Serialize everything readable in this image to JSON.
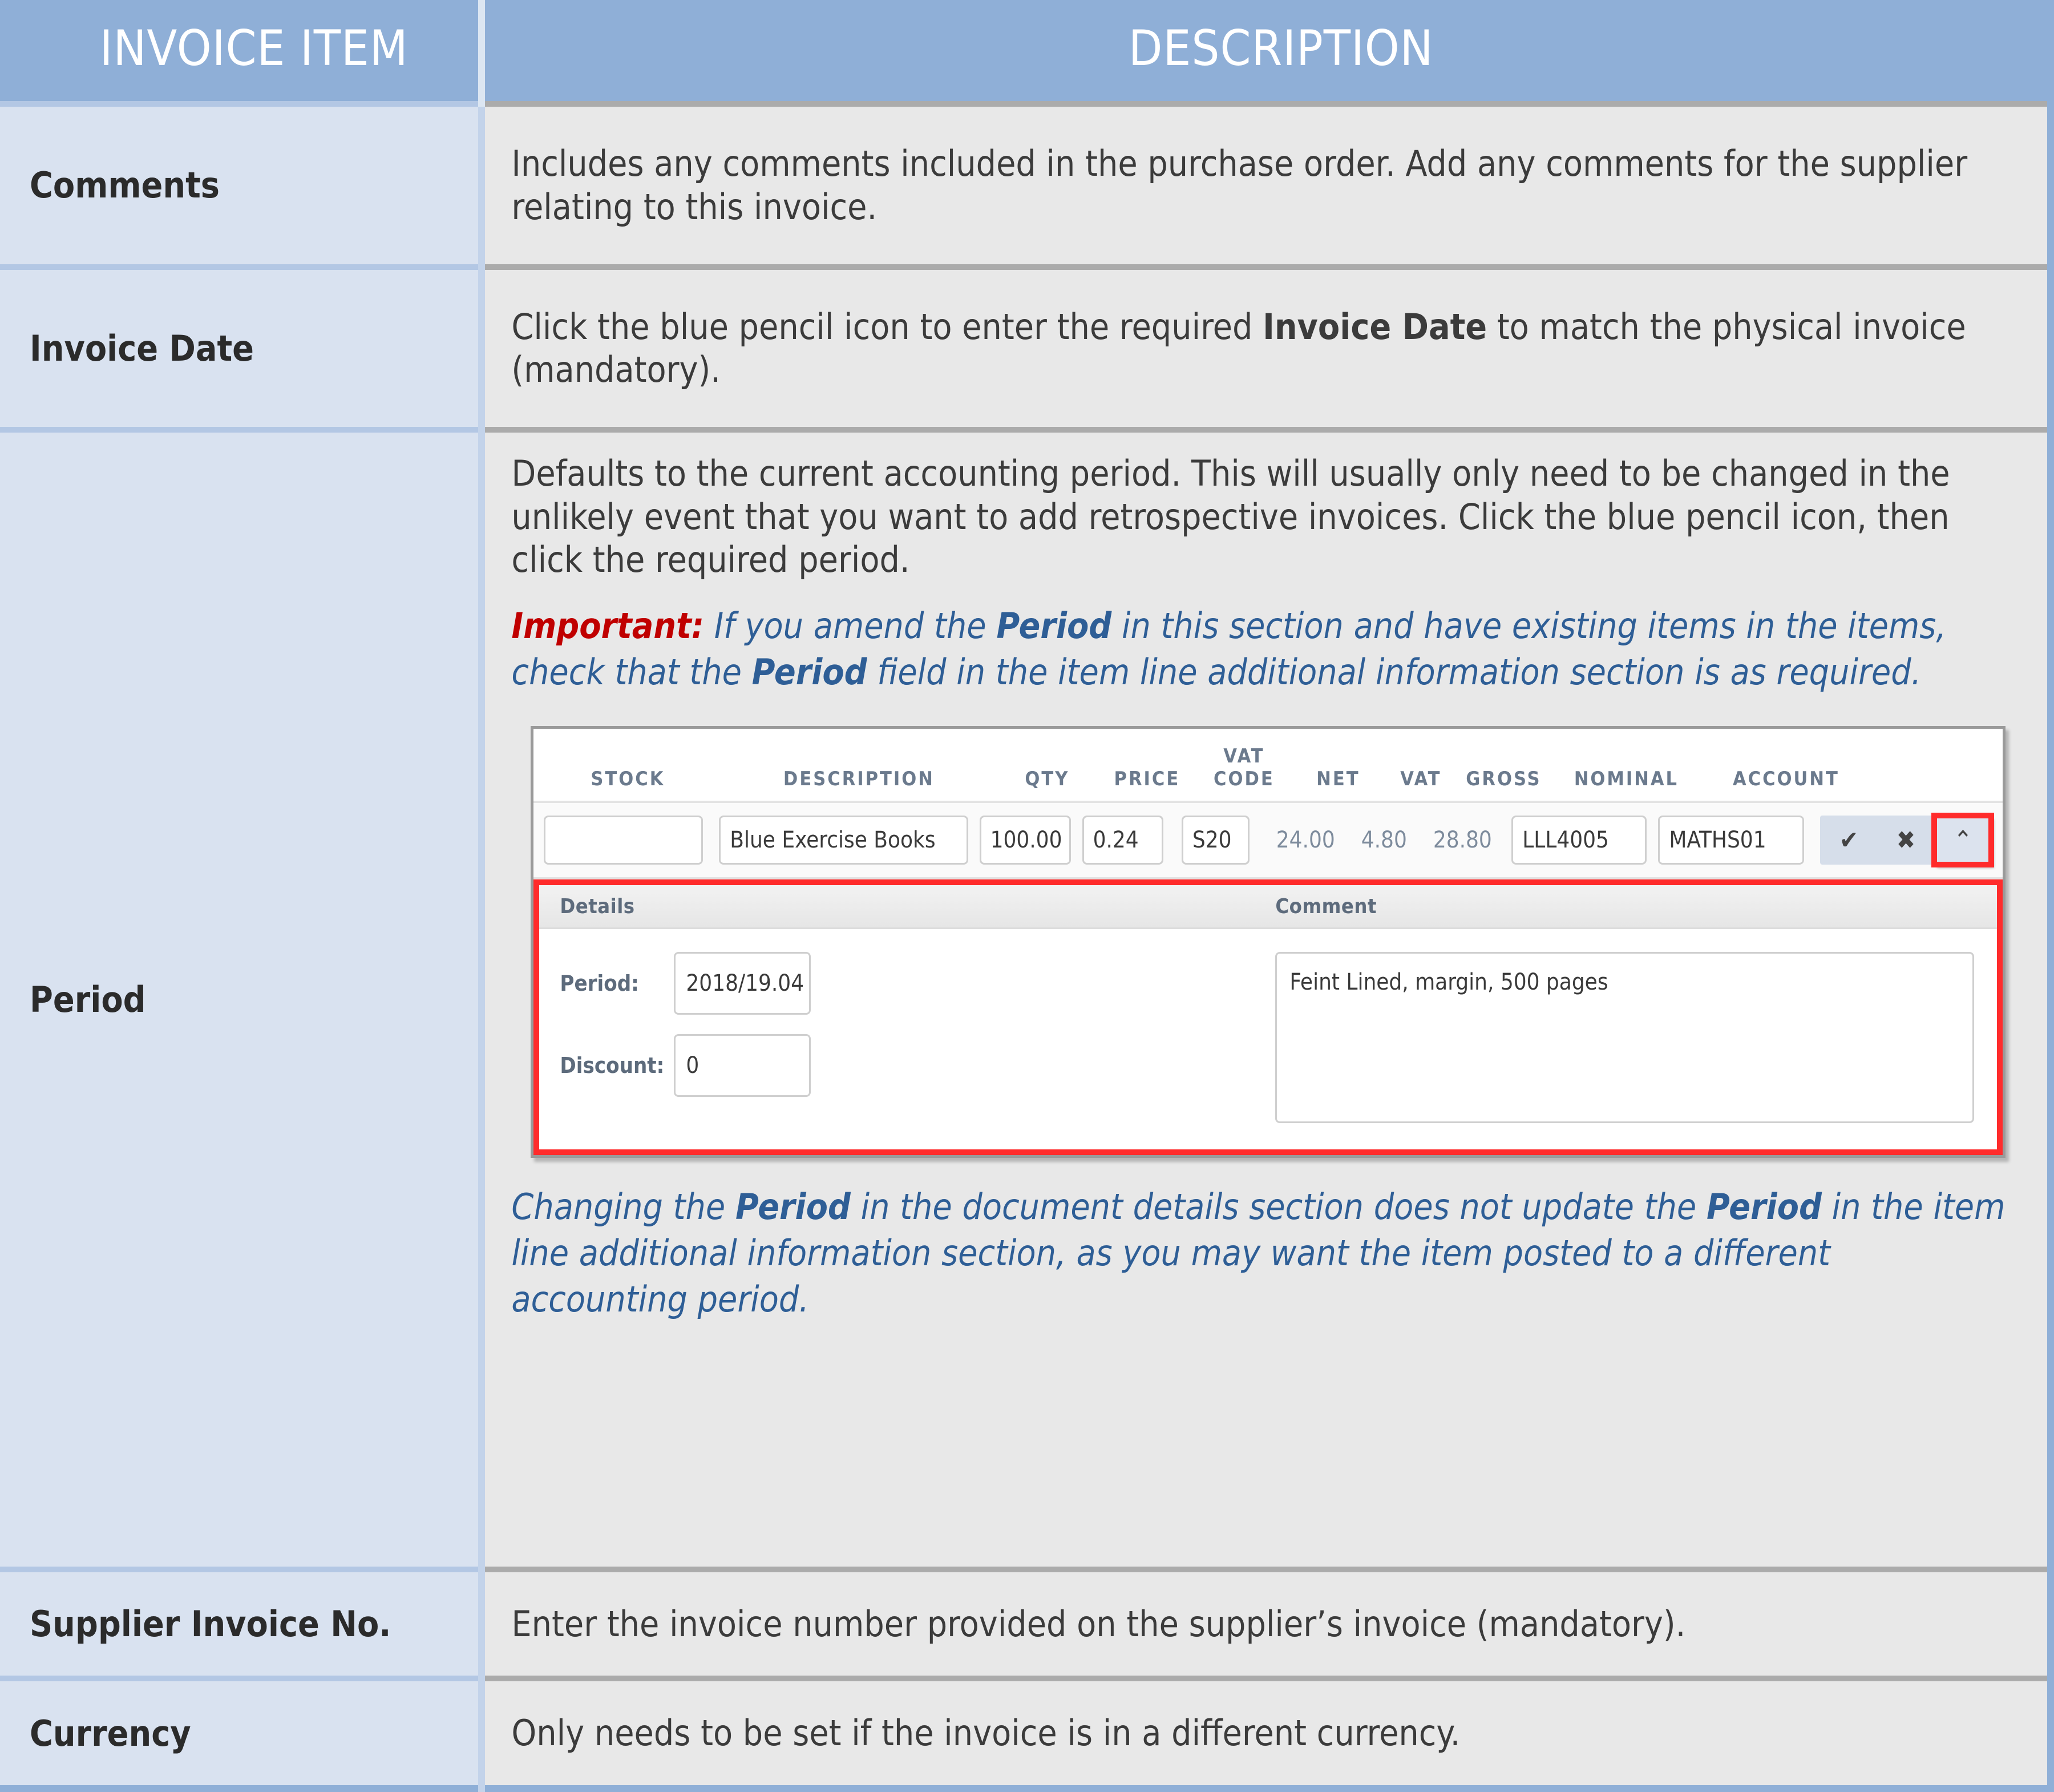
{
  "table": {
    "headers": {
      "item": "INVOICE ITEM",
      "description": "DESCRIPTION"
    },
    "rows": [
      {
        "item": "Comments",
        "desc_p1": "Includes any comments included in the purchase order. Add any comments for the supplier relating to this invoice."
      },
      {
        "item": "Invoice Date",
        "desc_a": "Click the blue pencil icon to enter the required ",
        "desc_b": "Invoice Date",
        "desc_c": " to match the physical invoice (mandatory)."
      },
      {
        "item": "Period",
        "desc_p1": "Defaults to the current accounting period. This will usually only need to be changed in the unlikely event that you want to add retrospective invoices. Click the blue pencil icon, then click the required period.",
        "note1": {
          "important": "Important:",
          "a": " If you amend the ",
          "b1": "Period",
          "c": " in this section and have existing items in the items, check that the ",
          "b2": "Period",
          "d": " field in the item line additional information section is as required."
        },
        "note2": {
          "a": "Changing the ",
          "b1": "Period",
          "c": " in the document details section does not update the ",
          "b2": "Period",
          "d": " in the item line additional information section, as you may want the item posted to a different accounting period."
        }
      },
      {
        "item": "Supplier Invoice No.",
        "desc_p1": "Enter the invoice number provided on the supplier’s invoice (mandatory)."
      },
      {
        "item": "Currency",
        "desc_p1": "Only needs to be set if the invoice is in a different currency."
      }
    ]
  },
  "screenshot": {
    "columns": [
      "STOCK",
      "DESCRIPTION",
      "QTY",
      "PRICE",
      "VAT CODE",
      "NET",
      "VAT",
      "GROSS",
      "NOMINAL",
      "ACCOUNT"
    ],
    "col_vat_code_line1": "VAT",
    "col_vat_code_line2": "CODE",
    "item_line": {
      "stock": "",
      "description": "Blue Exercise Books",
      "qty": "100.00",
      "price": "0.24",
      "vat_code": "S20",
      "net": "24.00",
      "vat": "4.80",
      "gross": "28.80",
      "nominal": "LLL4005",
      "account": "MATHS01"
    },
    "actions": {
      "confirm": "✔",
      "cancel": "✖",
      "collapse": "⌃"
    },
    "details_panel": {
      "details_title": "Details",
      "comment_title": "Comment",
      "period_label": "Period:",
      "period_value": "2018/19.04",
      "discount_label": "Discount:",
      "discount_value": "0",
      "comment_value": "Feint Lined, margin, 500 pages"
    },
    "highlight_color": "#FF2B2B"
  },
  "colors": {
    "header_blue": "#8FAFD7",
    "item_cell_blue": "#D9E2F0",
    "desc_cell_grey": "#E8E8E8",
    "note_blue": "#2E5E96",
    "important_red": "#C00000"
  }
}
